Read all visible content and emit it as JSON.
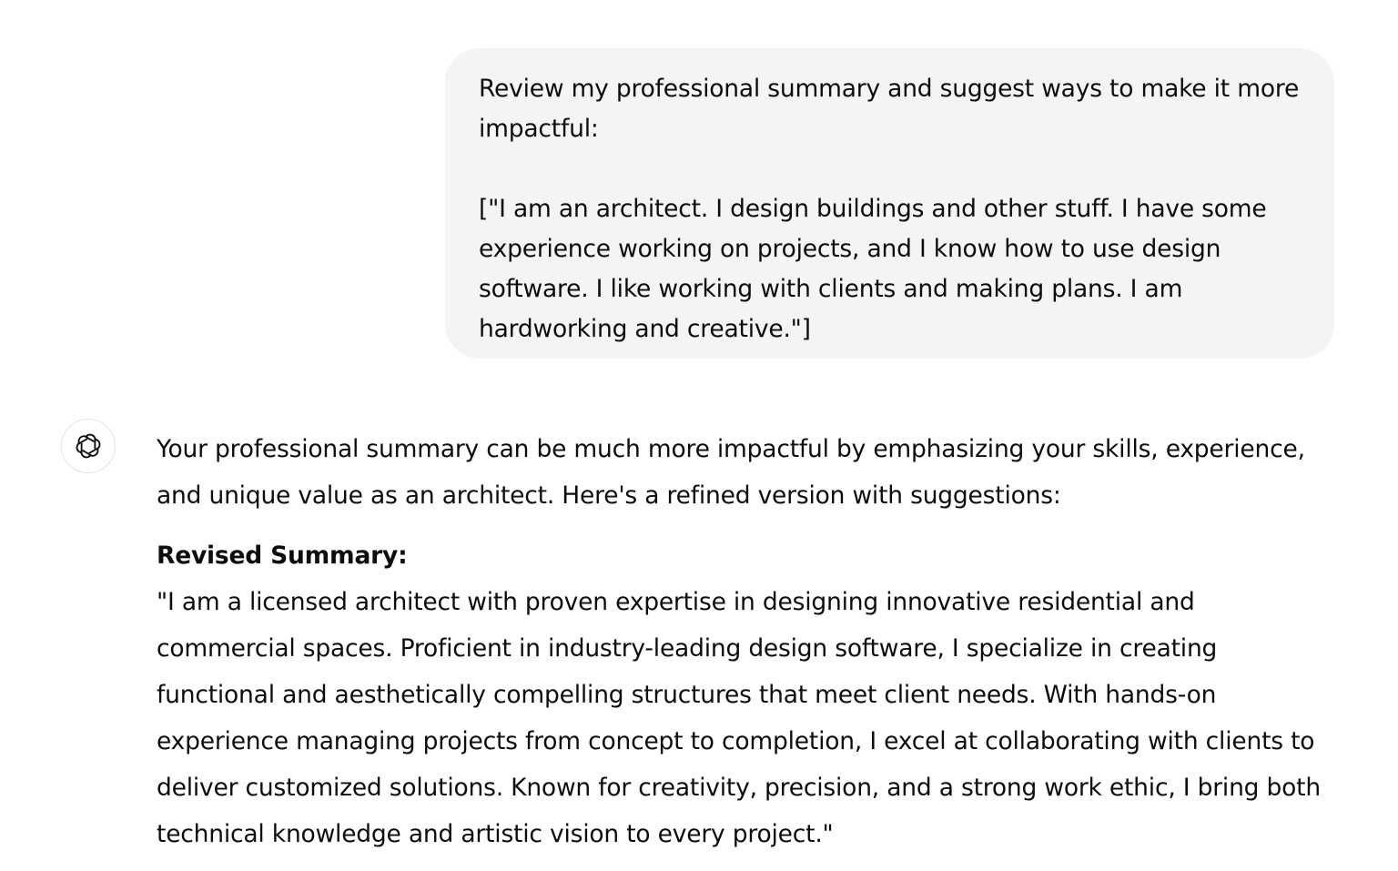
{
  "user_message": {
    "paragraph_1": "Review my professional summary and suggest ways to make it more impactful:",
    "paragraph_2": "[\"I am an architect. I design buildings and other stuff. I have some experience working on projects, and I know how to use design software. I like working with clients and making plans. I am hardworking and creative.\"]"
  },
  "assistant_message": {
    "avatar_icon": "openai-logo-icon",
    "intro": "Your professional summary can be much more impactful by emphasizing your skills, experience, and unique value as an architect. Here's a refined version with suggestions:",
    "heading": "Revised Summary:",
    "revised_summary": "\"I am a licensed architect with proven expertise in designing innovative residential and commercial spaces. Proficient in industry-leading design software, I specialize in creating functional and aesthetically compelling structures that meet client needs. With hands-on experience managing projects from concept to completion, I excel at collaborating with clients to deliver customized solutions. Known for creativity, precision, and a strong work ethic, I bring both technical knowledge and artistic vision to every project.\""
  },
  "colors": {
    "user_bubble_bg": "#f4f4f4",
    "text": "#0d0d0d",
    "avatar_border": "#e3e3e3"
  }
}
